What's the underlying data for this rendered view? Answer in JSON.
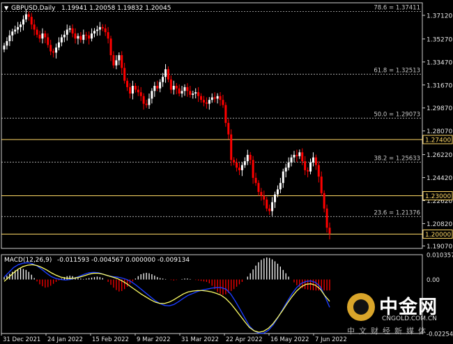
{
  "title": {
    "symbol": "GBPUSD,Daily",
    "ohlc": "1.19941 1.20058 1.19832 1.20045"
  },
  "macd": {
    "label": "MACD(12,26,9)",
    "values": "-0.011593 -0.004567 0.000000 -0.009134",
    "axis_labels": [
      {
        "value": 0.010357,
        "text": "0.010357"
      },
      {
        "value": 0.0,
        "text": "0.00"
      },
      {
        "value": -0.022547,
        "text": "-0.022547"
      }
    ]
  },
  "watermark": {
    "main": "中金网",
    "domain": "CNGOLD.COM.CN",
    "sub": "中文财经新媒体"
  },
  "colors": {
    "background": "#000000",
    "bull": "#ffffff",
    "bear": "#ff0000",
    "grid": "#c0c0c0",
    "level_line": "#ffd966",
    "macd_line": "#1a3cff",
    "signal_line": "#ffff66"
  },
  "chart_data": {
    "type": "candlestick",
    "symbol": "GBPUSD",
    "timeframe": "Daily",
    "ylim": [
      1.1888,
      1.381
    ],
    "y_ticks": [
      1.3712,
      1.3527,
      1.3347,
      1.3167,
      1.2987,
      1.2807,
      1.2622,
      1.2442,
      1.2262,
      1.2082,
      1.1907
    ],
    "x_labels": [
      "31 Dec 2021",
      "24 Jan 2022",
      "15 Feb 2022",
      "9 Mar 2022",
      "31 Mar 2022",
      "22 Apr 2022",
      "16 May 2022",
      "7 Jun 2022"
    ],
    "fib_levels": [
      {
        "label": "78.6 = 1.37411",
        "value": 1.37411
      },
      {
        "label": "61.8 = 1.32513",
        "value": 1.32513
      },
      {
        "label": "50.0 = 1.29073",
        "value": 1.29073
      },
      {
        "label": "38.2 = 1.25633",
        "value": 1.25633
      },
      {
        "label": "23.6 = 1.21376",
        "value": 1.21376
      }
    ],
    "horizontal_levels": [
      {
        "label": "1.27400",
        "value": 1.274
      },
      {
        "label": "1.23000",
        "value": 1.23
      },
      {
        "label": "1.20000",
        "value": 1.2
      }
    ],
    "close_path": [
      1.3475,
      1.351,
      1.3555,
      1.3585,
      1.36,
      1.362,
      1.364,
      1.368,
      1.372,
      1.37,
      1.364,
      1.36,
      1.356,
      1.353,
      1.357,
      1.354,
      1.348,
      1.343,
      1.342,
      1.346,
      1.35,
      1.354,
      1.356,
      1.36,
      1.361,
      1.357,
      1.353,
      1.355,
      1.352,
      1.356,
      1.3555,
      1.353,
      1.357,
      1.359,
      1.36,
      1.362,
      1.361,
      1.358,
      1.353,
      1.34,
      1.332,
      1.336,
      1.34,
      1.33,
      1.32,
      1.315,
      1.31,
      1.316,
      1.313,
      1.311,
      1.308,
      1.302,
      1.301,
      1.306,
      1.312,
      1.316,
      1.314,
      1.319,
      1.323,
      1.329,
      1.321,
      1.313,
      1.316,
      1.314,
      1.31,
      1.312,
      1.315,
      1.312,
      1.309,
      1.31,
      1.311,
      1.308,
      1.305,
      1.303,
      1.302,
      1.305,
      1.307,
      1.306,
      1.308,
      1.305,
      1.301,
      1.287,
      1.278,
      1.258,
      1.256,
      1.252,
      1.25,
      1.254,
      1.257,
      1.262,
      1.258,
      1.244,
      1.24,
      1.233,
      1.23,
      1.227,
      1.22,
      1.218,
      1.225,
      1.231,
      1.235,
      1.24,
      1.249,
      1.252,
      1.256,
      1.26,
      1.262,
      1.261,
      1.264,
      1.257,
      1.25,
      1.249,
      1.256,
      1.26,
      1.254,
      1.245,
      1.232,
      1.22,
      1.205,
      1.20045
    ],
    "macd_histogram_path": [
      0.001,
      0.0016,
      0.0024,
      0.0032,
      0.0038,
      0.0042,
      0.0046,
      0.0044,
      0.004,
      0.0032,
      0.002,
      0.0006,
      -0.0008,
      -0.002,
      -0.0028,
      -0.0034,
      -0.0032,
      -0.0026,
      -0.0018,
      -0.001,
      -0.0004,
      0.0004,
      0.001,
      0.0014,
      0.0016,
      0.0014,
      0.001,
      0.0006,
      0.0004,
      0.0002,
      0.0004,
      0.0006,
      0.0008,
      0.001,
      0.0012,
      0.001,
      0.0006,
      0.0,
      -0.001,
      -0.0022,
      -0.0034,
      -0.0044,
      -0.005,
      -0.0048,
      -0.004,
      -0.003,
      -0.0018,
      -0.0008,
      0.0004,
      0.0014,
      0.0022,
      0.0026,
      0.0028,
      0.0026,
      0.0022,
      0.0016,
      0.001,
      0.0006,
      0.0004,
      0.0002,
      0.0,
      -0.0002,
      -0.0004,
      -0.0002,
      0.0,
      0.0002,
      0.0004,
      0.0004,
      0.0002,
      0.0,
      -0.0002,
      -0.0004,
      -0.0006,
      -0.0008,
      -0.001,
      -0.0016,
      -0.0026,
      -0.004,
      -0.0052,
      -0.006,
      -0.0064,
      -0.0062,
      -0.0056,
      -0.0048,
      -0.004,
      -0.003,
      -0.002,
      -0.001,
      0.0,
      0.0012,
      0.0026,
      0.0042,
      0.0058,
      0.0072,
      0.0082,
      0.0088,
      0.0092,
      0.009,
      0.0084,
      0.0076,
      0.0066,
      0.0054,
      0.004,
      0.0026,
      0.0012,
      0.0,
      -0.0012,
      -0.0024,
      -0.003,
      -0.0036,
      -0.004,
      -0.0042,
      -0.0044,
      -0.0045,
      -0.0046,
      -0.0046,
      -0.0046,
      -0.0046,
      -0.0046,
      -0.004567
    ],
    "macd_line_path": [
      0.001,
      0.003,
      0.005,
      0.0062,
      0.0068,
      0.007,
      0.0066,
      0.0056,
      0.0042,
      0.0026,
      0.0012,
      0.0004,
      0.0,
      -0.0002,
      0.0,
      0.0006,
      0.0014,
      0.0022,
      0.0028,
      0.003,
      0.0028,
      0.0022,
      0.0016,
      0.0012,
      0.001,
      0.0006,
      0.0,
      -0.001,
      -0.0024,
      -0.004,
      -0.0056,
      -0.0072,
      -0.0088,
      -0.01,
      -0.0108,
      -0.011,
      -0.0104,
      -0.0092,
      -0.0078,
      -0.0066,
      -0.0058,
      -0.005,
      -0.0044,
      -0.004,
      -0.0036,
      -0.0034,
      -0.0034,
      -0.004,
      -0.006,
      -0.009,
      -0.0124,
      -0.016,
      -0.0194,
      -0.0214,
      -0.0224,
      -0.0224,
      -0.0212,
      -0.019,
      -0.016,
      -0.0126,
      -0.0092,
      -0.006,
      -0.0034,
      -0.0016,
      -0.0008,
      -0.0006,
      -0.0012,
      -0.003,
      -0.007,
      -0.0116
    ],
    "signal_line_path": [
      -0.0008,
      0.001,
      0.0028,
      0.0044,
      0.0054,
      0.006,
      0.0062,
      0.0058,
      0.005,
      0.004,
      0.0028,
      0.0018,
      0.001,
      0.0006,
      0.0004,
      0.0006,
      0.001,
      0.0016,
      0.0022,
      0.0026,
      0.0026,
      0.0022,
      0.0016,
      0.001,
      0.0004,
      -0.0006,
      -0.0018,
      -0.0032,
      -0.0046,
      -0.006,
      -0.0072,
      -0.0084,
      -0.0094,
      -0.01,
      -0.01,
      -0.0094,
      -0.0084,
      -0.0072,
      -0.006,
      -0.0052,
      -0.0048,
      -0.0046,
      -0.0046,
      -0.0048,
      -0.0052,
      -0.0058,
      -0.0066,
      -0.008,
      -0.01,
      -0.0124,
      -0.015,
      -0.0176,
      -0.02,
      -0.0214,
      -0.022,
      -0.0216,
      -0.0204,
      -0.0184,
      -0.0158,
      -0.013,
      -0.01,
      -0.0072,
      -0.0048,
      -0.003,
      -0.002,
      -0.0018,
      -0.0024,
      -0.004,
      -0.0068,
      -0.0091
    ]
  }
}
